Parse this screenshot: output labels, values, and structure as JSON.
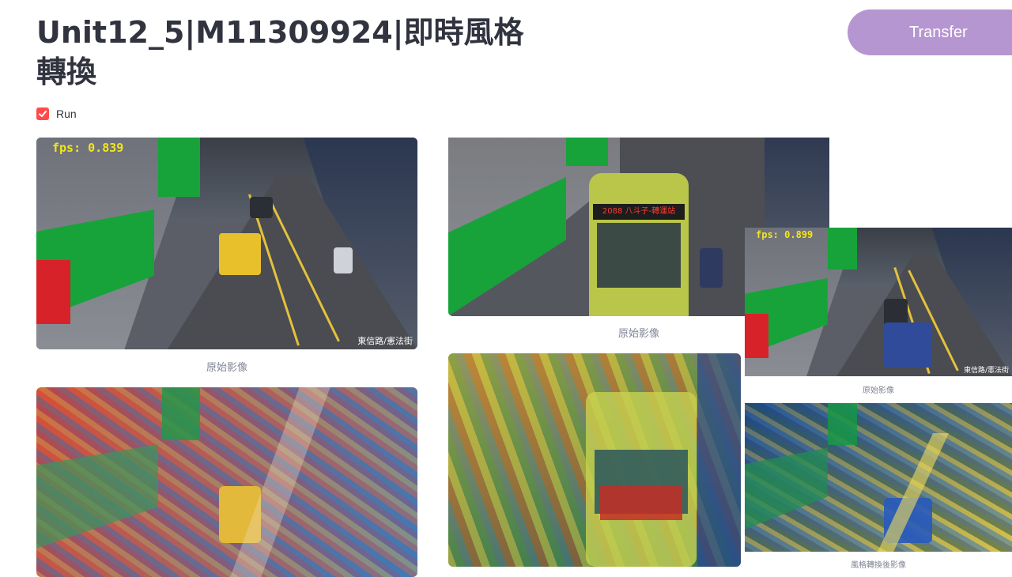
{
  "header": {
    "title": "Unit12_5|M11309924|即時風格轉換",
    "transfer_label": "Transfer"
  },
  "controls": {
    "run_label": "Run",
    "run_checked": true
  },
  "frames": {
    "left_original": {
      "fps": "fps: 0.839",
      "signature": "東信路/憲法街",
      "caption": "原始影像"
    },
    "left_stylized": {
      "caption": ""
    },
    "middle_original": {
      "caption": "原始影像",
      "bus_text": "2088 八斗子-轉運站"
    },
    "middle_stylized": {
      "caption": ""
    },
    "right_original": {
      "fps": "fps: 0.899",
      "signature": "東信路/憲法街",
      "caption": "原始影像"
    },
    "right_stylized": {
      "caption": "風格轉換後影像"
    }
  },
  "colors": {
    "accent": "#ff4b4b",
    "button": "#b696d1",
    "sign_green": "#17a33a",
    "fps_yellow": "#f2e51a"
  },
  "icons": {
    "checkbox": "check-icon"
  }
}
